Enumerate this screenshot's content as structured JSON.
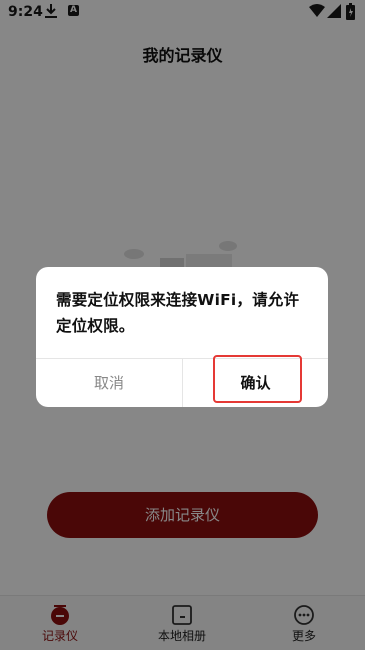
{
  "status_bar": {
    "time": "9:24",
    "icons": [
      "download-icon",
      "app-notification-icon",
      "wifi-icon",
      "signal-icon",
      "battery-icon"
    ]
  },
  "header": {
    "title": "我的记录仪"
  },
  "main": {
    "add_button_label": "添加记录仪"
  },
  "bottom_nav": {
    "items": [
      {
        "label": "记录仪",
        "icon": "recorder-icon",
        "active": true
      },
      {
        "label": "本地相册",
        "icon": "album-icon",
        "active": false
      },
      {
        "label": "更多",
        "icon": "more-icon",
        "active": false
      }
    ]
  },
  "dialog": {
    "message": "需要定位权限来连接WiFi，请允许定位权限。",
    "cancel_label": "取消",
    "confirm_label": "确认"
  },
  "colors": {
    "accent": "#8c0e0e",
    "highlight": "#e53935",
    "overlay": "rgba(0,0,0,0.47)"
  }
}
